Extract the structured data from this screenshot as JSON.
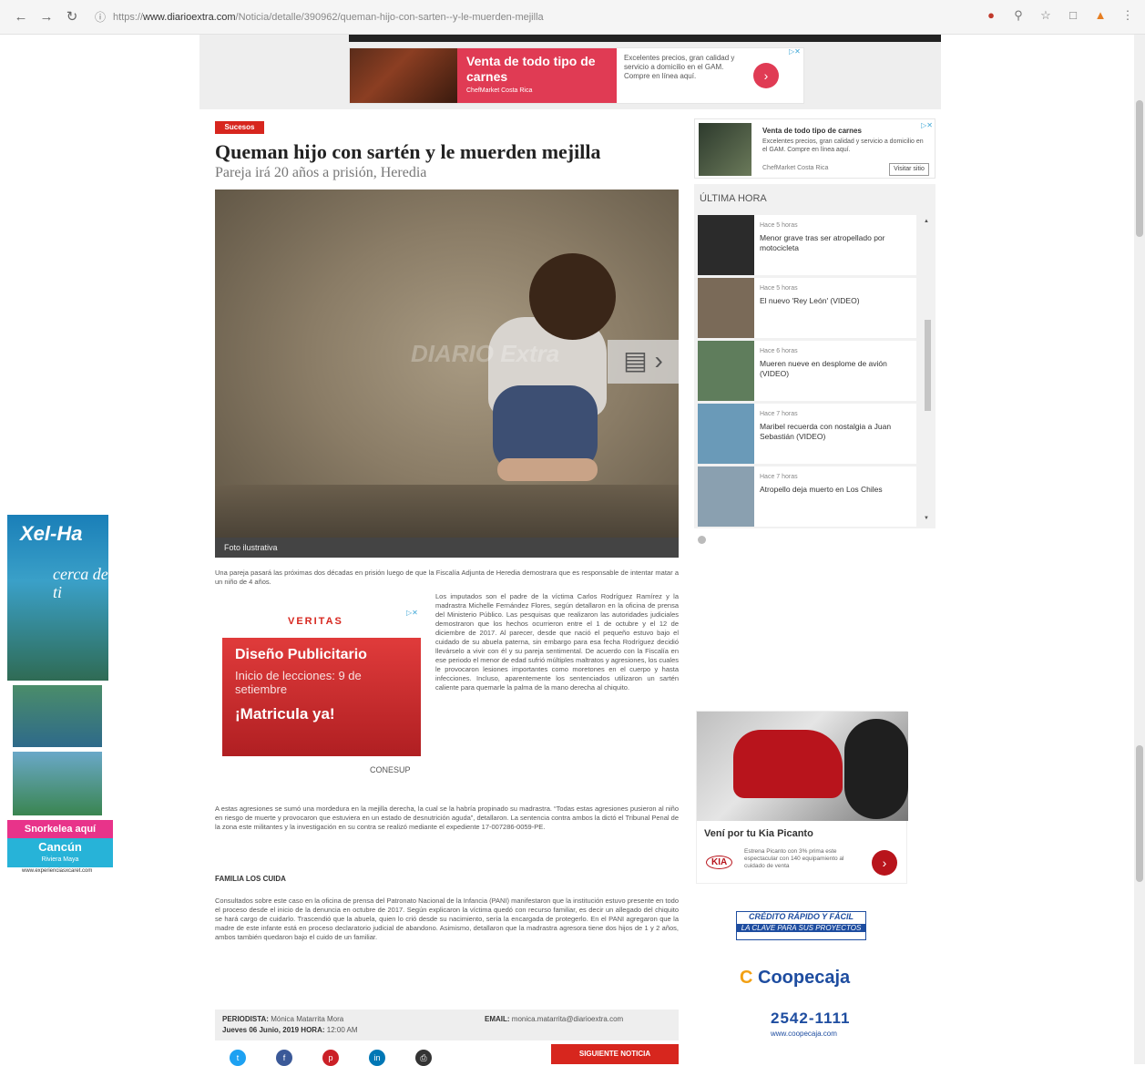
{
  "browser": {
    "url_scheme": "https://",
    "url_domain": "www.diarioextra.com",
    "url_path": "/Noticia/detalle/390962/queman-hijo-con-sarten--y-le-muerden-mejilla",
    "icons": [
      "back-icon",
      "forward-icon",
      "reload-icon",
      "info-icon",
      "extension-icon",
      "zoom-icon",
      "star-icon",
      "extension-icon",
      "extension-icon",
      "menu-icon"
    ]
  },
  "top_ad": {
    "title": "Venta de todo tipo de carnes",
    "brand": "ChefMarket Costa Rica",
    "description": "Excelentes precios, gran calidad y servicio a domicilio en el GAM. Compre en línea aquí.",
    "go_icon": "chevron-right-icon"
  },
  "article": {
    "section": "Sucesos",
    "headline": "Queman hijo con sartén y le muerden mejilla",
    "subhead": "Pareja irá 20 años a prisión, Heredia",
    "photo_caption": "Foto ilustrativa",
    "photo_watermark": "DIARIO Extra",
    "lead": "Una pareja pasará las próximas dos décadas en prisión luego de que la Fiscalía Adjunta de Heredia demostrara que es responsable de intentar matar a un niño de 4 años.",
    "col_right": "Los imputados son el padre de la víctima Carlos Rodríguez Ramírez y la madrastra Michelle Fernández Flores, según detallaron en la oficina de prensa del Ministerio Público. Las pesquisas que realizaron las autoridades judiciales demostraron que los hechos ocurrieron entre el 1 de octubre y el 12 de diciembre de 2017. Al parecer, desde que nació el pequeño estuvo bajo el cuidado de su abuela paterna, sin embargo para esa fecha Rodríguez decidió llevárselo a vivir con él y su pareja sentimental. De acuerdo con la Fiscalía en ese periodo el menor de edad sufrió múltiples maltratos y agresiones, los cuales le provocaron lesiones importantes como moretones en el cuerpo y hasta infecciones. Incluso, aparentemente los sentenciados utilizaron un sartén caliente para quemarle la palma de la mano derecha al chiquito.",
    "full1": "A estas agresiones se sumó una mordedura en la mejilla derecha, la cual se la habría propinado su madrastra. “Todas estas agresiones pusieron al niño en riesgo de muerte y provocaron que estuviera en un estado de desnutrición aguda”, detallaron. La sentencia contra ambos la dictó el Tribunal Penal de la zona este militantes y la investigación en su contra se realizó mediante el expediente 17-007286-0059-PE.",
    "subtitle": "FAMILIA LOS CUIDA",
    "full2": "Consultados sobre este caso en la oficina de prensa del Patronato Nacional de la Infancia (PANI) manifestaron que la institución estuvo presente en todo el proceso desde el inicio de la denuncia en octubre de 2017. Según explicaron la víctima quedó con recurso familiar, es decir un allegado del chiquito se hará cargo de cuidarlo. Trascendió que la abuela, quien lo crió desde su nacimiento, sería la encargada de protegerlo. En el PANI agregaron que la madre de este infante está en proceso declaratorio judicial de abandono. Asimismo, detallaron que la madrastra agresora tiene dos hijos de 1 y 2 años, ambos también quedaron bajo el cuido de un familiar.",
    "journalist_label": "PERIODISTA:",
    "journalist": "Mónica Matarrita Mora",
    "date_label": "Jueves 06 Junio, 2019",
    "time_label": "HORA:",
    "time": "12:00 AM",
    "email_label": "EMAIL:",
    "email": "monica.matarrita@diarioextra.com",
    "next_label": "SIGUIENTE NOTICIA"
  },
  "inline_ad": {
    "logo": "VERITAS",
    "line1": "Diseño Publicitario",
    "line2": "Inicio de lecciones: 9 de setiembre",
    "line3": "¡Matricula ya!",
    "footer": "CONESUP"
  },
  "sidebar_ad": {
    "title": "Venta de todo tipo de carnes",
    "description": "Excelentes precios, gran calidad y servicio a domicilio en el GAM. Compre en línea aquí.",
    "brand": "ChefMarket Costa Rica",
    "cta": "Visitar sitio"
  },
  "latest": {
    "title": "ÚLTIMA HORA",
    "items": [
      {
        "time": "Hace 5 horas",
        "title": "Menor grave tras ser atropellado por motocicleta",
        "color": "#2b2b2b"
      },
      {
        "time": "Hace 5 horas",
        "title": "El nuevo 'Rey León' (VIDEO)",
        "color": "#7a6a58"
      },
      {
        "time": "Hace 6 horas",
        "title": "Mueren nueve en desplome de avión (VIDEO)",
        "color": "#5f7d5c"
      },
      {
        "time": "Hace 7 horas",
        "title": "Maribel recuerda con nostalgia a Juan Sebastián (VIDEO)",
        "color": "#6a9ab8"
      },
      {
        "time": "Hace 7 horas",
        "title": "Atropello deja muerto en Los Chiles",
        "color": "#8aa0b0"
      }
    ]
  },
  "kia_ad": {
    "title": "Vení por tu Kia Picanto",
    "logo": "KIA",
    "description": "Estrena Picanto con 3% prima este espectacular con 140 equipamiento al cuidado de venta",
    "go_icon": "chevron-right-icon"
  },
  "coop_ad": {
    "line1": "CRÉDITO RÁPIDO Y FÁCIL",
    "line2": "LA CLAVE PARA SUS PROYECTOS",
    "brand": "Coopecaja",
    "phone": "2542-1111",
    "web": "www.coopecaja.com"
  },
  "left_ad": {
    "brand": "Xel-Ha",
    "tagline": "cerca de ti",
    "snorkel": "Snorkelea aquí",
    "city": "Cancún",
    "region": "Riviera Maya",
    "url": "www.experienciasxcaret.com"
  }
}
